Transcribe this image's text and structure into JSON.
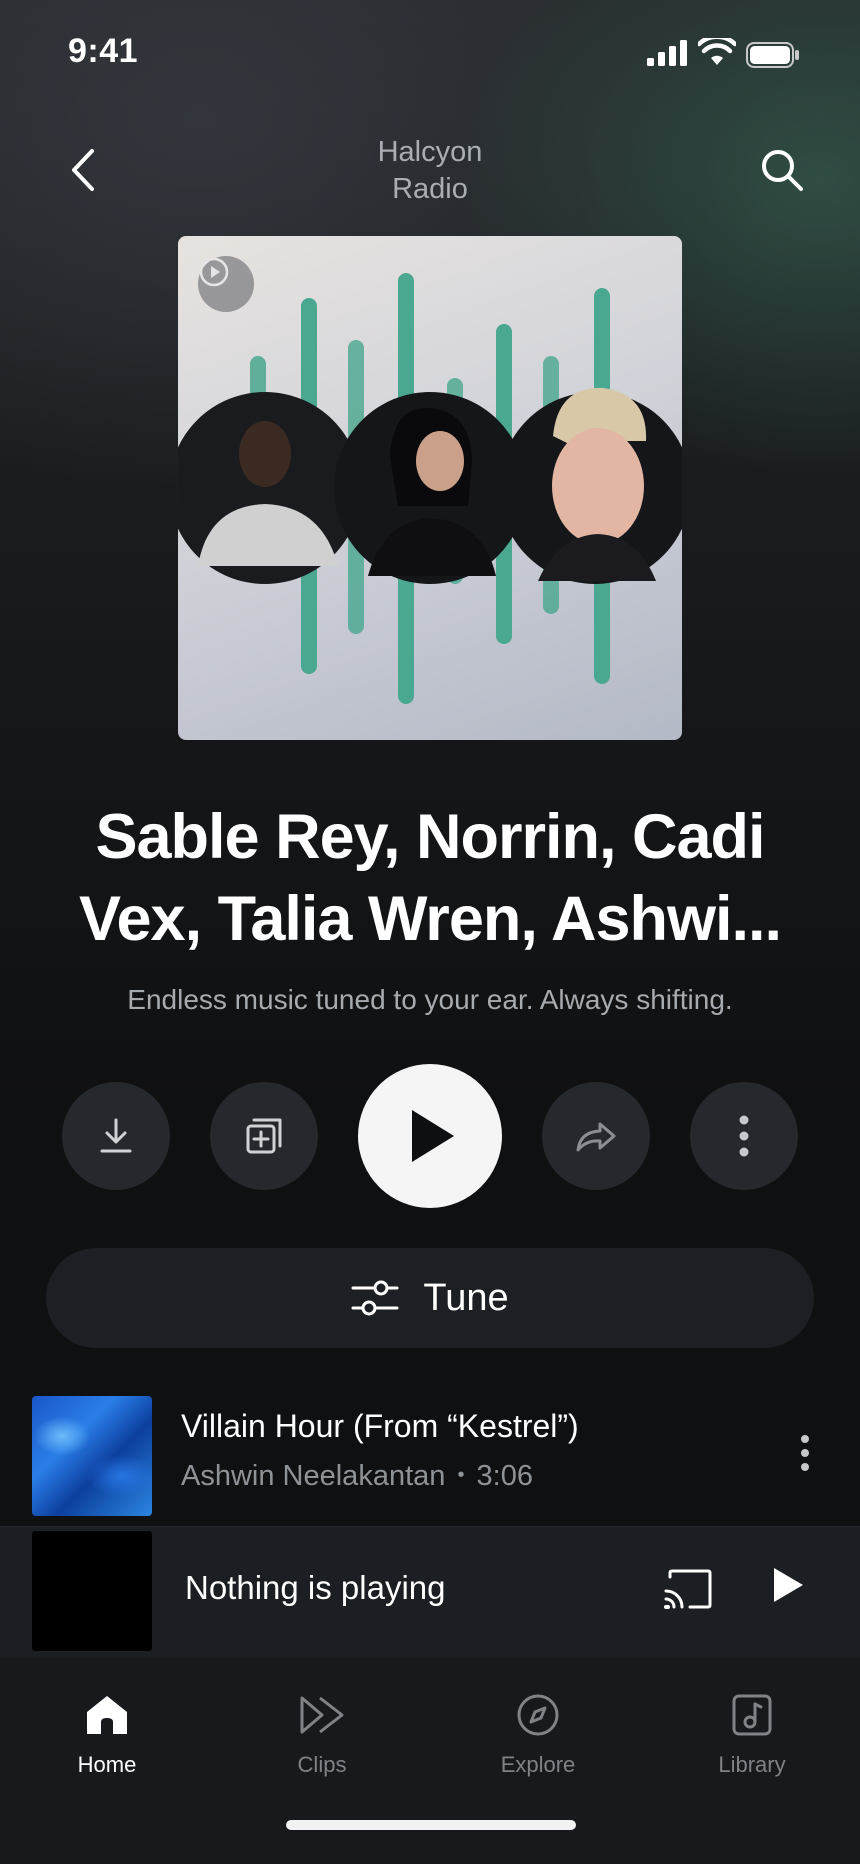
{
  "status_bar": {
    "time": "9:41",
    "icons": [
      "cellular-signal-icon",
      "wifi-icon",
      "battery-icon"
    ]
  },
  "header": {
    "title_line1": "Halcyon",
    "title_line2": "Radio",
    "back_icon": "chevron-left-icon",
    "search_icon": "search-icon"
  },
  "artwork": {
    "badge_icon": "radio-play-icon",
    "bar_color": "#4aa890",
    "portraits": [
      "artist-portrait-1",
      "artist-portrait-2",
      "artist-portrait-3"
    ]
  },
  "station": {
    "title": "Sable Rey, Norrin, Cadi Vex, Talia Wren, Ashwi...",
    "description": "Endless music tuned to your ear. Always shifting."
  },
  "actions": {
    "download_icon": "download-icon",
    "save_icon": "add-to-library-icon",
    "play_icon": "play-icon",
    "share_icon": "share-icon",
    "more_icon": "more-vertical-icon"
  },
  "tune": {
    "label": "Tune",
    "icon": "sliders-icon"
  },
  "tracks": [
    {
      "title": "Villain Hour (From “Kestrel”)",
      "artist": "Ashwin Neelakantan",
      "separator": "•",
      "duration": "3:06"
    }
  ],
  "mini_player": {
    "text": "Nothing is playing",
    "cast_icon": "cast-icon",
    "play_icon": "play-icon"
  },
  "bottom_nav": {
    "items": [
      {
        "label": "Home",
        "icon": "home-icon",
        "active": true
      },
      {
        "label": "Clips",
        "icon": "clips-icon",
        "active": false
      },
      {
        "label": "Explore",
        "icon": "compass-icon",
        "active": false
      },
      {
        "label": "Library",
        "icon": "library-icon",
        "active": false
      }
    ]
  },
  "colors": {
    "background": "#101214",
    "accent_green": "#4aa890",
    "muted_text": "#a6abb0",
    "play_button": "#f5f5f5"
  }
}
